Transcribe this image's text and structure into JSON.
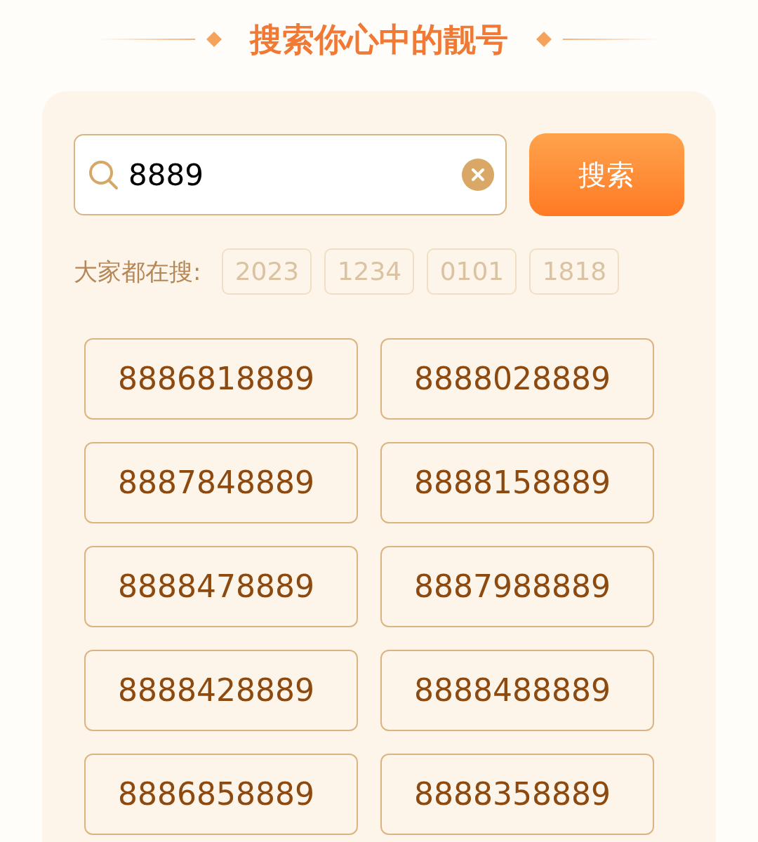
{
  "title": "搜索你心中的靓号",
  "search": {
    "value": "8889",
    "button": "搜索"
  },
  "hot": {
    "label": "大家都在搜:",
    "tags": [
      "2023",
      "1234",
      "0101",
      "1818"
    ]
  },
  "numbers": [
    "8886818889",
    "8888028889",
    "8887848889",
    "8888158889",
    "8888478889",
    "8887988889",
    "8888428889",
    "8888488889",
    "8886858889",
    "8888358889"
  ]
}
